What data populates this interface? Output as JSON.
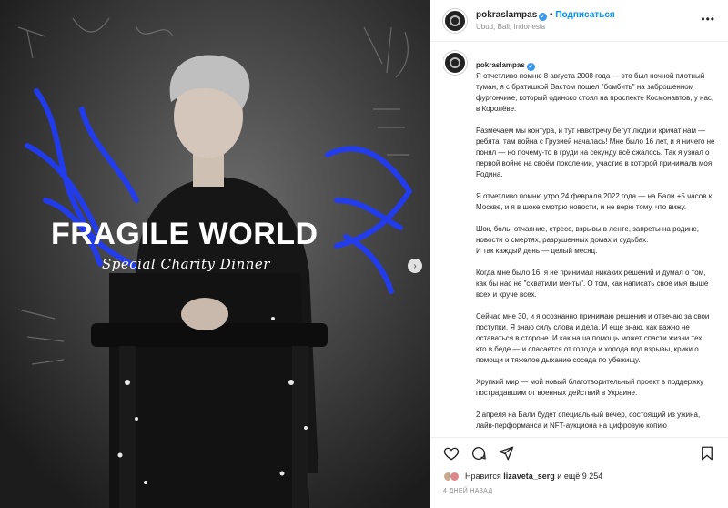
{
  "post": {
    "username": "pokraslampas",
    "follow_label": "Подписаться",
    "separator": "•",
    "location": "Ubud, Bali, Indonesia",
    "more_label": "•••",
    "verified_glyph": "✓"
  },
  "image": {
    "title": "FRAGILE WORLD",
    "subtitle": "Special Charity Dinner",
    "next_glyph": "›"
  },
  "caption": {
    "username": "pokraslampas",
    "paragraphs": [
      "Я отчетливо помню 8 августа 2008 года — это был ночной плотный туман, я с братишкой Вастом пошел \"бомбить\" на заброшенном фургончике, который одиноко стоял на проспекте Космонавтов, у нас, в Королёве.",
      "Размечаем мы контура, и тут навстречу бегут люди и кричат нам — ребята, там война с Грузией началась! Мне было 16 лет, и я ничего не понял — но почему-то в груди на секунду всё сжалось. Так я узнал о первой войне на своём поколении, участие в которой принимала моя Родина.",
      "Я отчетливо помню утро 24 февраля 2022 года — на Бали +5 часов к Москве, и я в шоке смотрю новости, и не верю тому, что вижу.",
      "Шок, боль, отчаяние, стресс, взрывы в ленте, запреты на родине, новости о смертях, разрушенных домах и судьбах.\nИ так каждый день — целый месяц.",
      "Когда мне было 16, я не принимал никаких решений и думал о том, как бы нас не \"схватили менты\". О том, как написать свое имя выше всех и круче всех.",
      "Сейчас мне 30, и я осознанно принимаю решения и отвечаю за свои поступки. Я знаю силу слова и дела. И еще знаю, как важно не оставаться в стороне. И как наша помощь может спасти жизни тех, кто в беде — и спасается от голода и холода под взрывы, крики о помощи и тяжелое дыхание соседа по убежищу.",
      "Хрупкий мир — мой новый благотворительный проект в поддержку пострадавшим от военных действий в Украине.",
      "2 апреля на Бали будет специальный вечер, состоящий из ужина, лайв-перформанса и NFT-аукциона на цифровую копию"
    ]
  },
  "likes": {
    "prefix": "Нравится",
    "user": "lizaveta_serg",
    "suffix": "и ещё 9 254"
  },
  "date": "4 ДНЕЙ НАЗАД",
  "icons": {
    "like": "heart-icon",
    "comment": "comment-icon",
    "share": "share-icon",
    "save": "bookmark-icon"
  }
}
